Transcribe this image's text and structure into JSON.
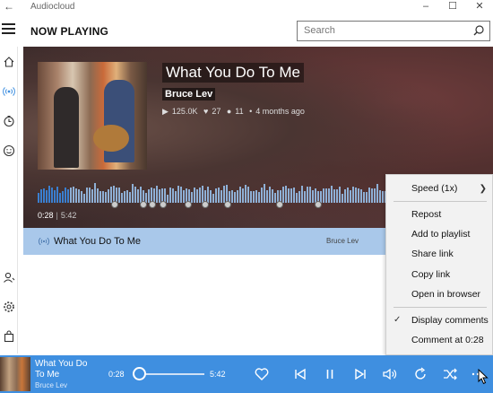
{
  "window": {
    "title": "Audiocloud"
  },
  "header": {
    "page_title": "NOW PLAYING",
    "search_placeholder": "Search"
  },
  "hero": {
    "title": "What You Do To Me",
    "artist": "Bruce Lev",
    "plays": "125.0K",
    "likes": "27",
    "comments": "11",
    "age": "4 months ago",
    "elapsed": "0:28",
    "duration": "5:42",
    "progress_fraction": 0.082
  },
  "playlist": [
    {
      "title": "What You Do To Me",
      "artist": "Bruce Lev"
    }
  ],
  "context_menu": {
    "speed": "Speed (1x)",
    "repost": "Repost",
    "add_to_playlist": "Add to playlist",
    "share_link": "Share link",
    "copy_link": "Copy link",
    "open_in_browser": "Open in browser",
    "display_comments": "Display comments",
    "display_comments_checked": true,
    "comment_at": "Comment at 0:28"
  },
  "player": {
    "title": "What You Do To Me",
    "artist": "Bruce Lev",
    "elapsed": "0:28",
    "duration": "5:42",
    "progress_fraction": 0.082
  },
  "colors": {
    "accent": "#3f8fe0",
    "selection": "#a9c8ea",
    "menu_bg": "#f2f2f2"
  }
}
